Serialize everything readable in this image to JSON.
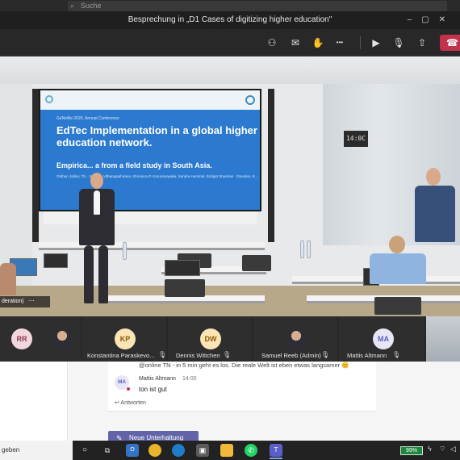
{
  "search": {
    "placeholder": "Suche"
  },
  "window": {
    "title": "Besprechung in „D1 Cases of digitizing higher education\""
  },
  "toolbar": {
    "buttons": [
      {
        "name": "participants-icon",
        "glyph": "⚇"
      },
      {
        "name": "chat-icon",
        "glyph": "✉"
      },
      {
        "name": "raise-hand-icon",
        "glyph": "✋"
      },
      {
        "name": "more-options-icon",
        "glyph": "•••"
      },
      {
        "name": "camera-icon",
        "glyph": "▶"
      },
      {
        "name": "mic-muted-icon",
        "glyph": "🎙"
      },
      {
        "name": "share-screen-icon",
        "glyph": "⇧"
      }
    ],
    "leave_glyph": "☎",
    "leave_color": "#c4314b"
  },
  "video": {
    "slide": {
      "conference": "GeNeMe 2020, Annual Conference",
      "title": "EdTec Implementation in a global higher education network.",
      "subtitle": "Empirica... a from a field study in South Asia.",
      "authors": "Orkhan Jalilov, Th... Munjula Vithanapathirana, Shironica P. Karunanayaka, Sandra Hummel, Bridget Sheehan · Dresden, 8..."
    },
    "clock": "14:0C",
    "name_tag": "deration)"
  },
  "participants": [
    {
      "initials": "RR",
      "name": "",
      "avatar_bg": "#f1d7dd",
      "avatar_fg": "#8d3a4e",
      "photo": false
    },
    {
      "initials": "",
      "name": "",
      "avatar_bg": "",
      "avatar_fg": "",
      "photo": true
    },
    {
      "initials": "KP",
      "name": "Konstantina Paraskevo...",
      "avatar_bg": "#fbe5b6",
      "avatar_fg": "#8a5a00",
      "photo": false
    },
    {
      "initials": "DW",
      "name": "Dennis Wittchen",
      "avatar_bg": "#fbe5b6",
      "avatar_fg": "#8a5a00",
      "photo": false
    },
    {
      "initials": "",
      "name": "Samuel Reeb (Admin)",
      "avatar_bg": "",
      "avatar_fg": "",
      "photo": true
    },
    {
      "initials": "MA",
      "name": "Mattis Altmann",
      "avatar_bg": "#e8e6f5",
      "avatar_fg": "#5b5fc7",
      "photo": false
    }
  ],
  "chat": {
    "previous_line": "@online TN - in 5 min geht es los. Die reale Welt ist eben etwas langsamer 😊",
    "message": {
      "initials": "MA",
      "author": "Mattis Altmann",
      "time": "14:00",
      "text": "ton ist gut"
    },
    "reply_label": "↩ Antworten",
    "new_conversation_label": "Neue Unterhaltung"
  },
  "taskbar": {
    "search_text": "geben",
    "battery": "99%",
    "battery_level": 0.99
  }
}
